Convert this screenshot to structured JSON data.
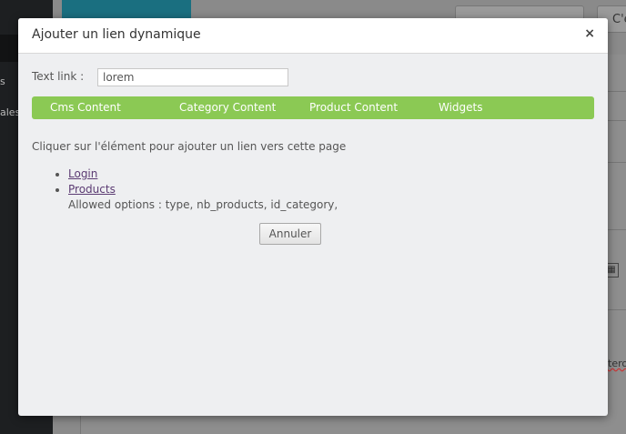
{
  "background": {
    "sidebar_items": [
      "s",
      "ales"
    ],
    "top_button_text": "C'e",
    "table_icon": "table-icon",
    "fragment_text": "tero"
  },
  "modal": {
    "title": "Ajouter un lien dynamique",
    "close_glyph": "×",
    "text_link_label": "Text link :",
    "text_link_value": "lorem",
    "tabs": [
      {
        "label": "Cms Content"
      },
      {
        "label": "Category Content"
      },
      {
        "label": "Product Content"
      },
      {
        "label": "Widgets"
      }
    ],
    "tabs_color": "#8bc954",
    "instruction": "Cliquer sur l'élément pour ajouter un lien vers cette page",
    "links": [
      {
        "label": "Login"
      },
      {
        "label": "Products",
        "note": "Allowed options : type, nb_products, id_category,"
      }
    ],
    "cancel_label": "Annuler"
  }
}
